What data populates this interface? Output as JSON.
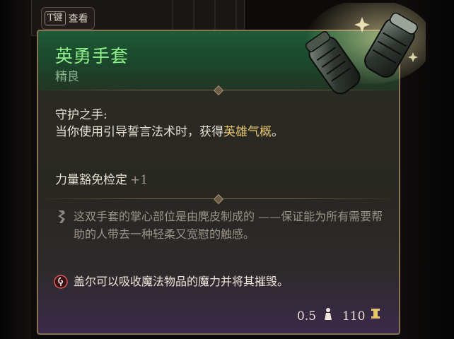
{
  "hint": {
    "key": "T键",
    "label": "查看"
  },
  "item": {
    "name": "英勇手套",
    "rarity": "精良",
    "passive_name": "守护之手:",
    "passive_desc_prefix": "当你使用引导誓言法术时，获得",
    "passive_desc_highlight": "英雄气概",
    "passive_desc_suffix": "。",
    "bonus_label": "力量豁免检定",
    "bonus_value": "+1",
    "lore": "这双手套的掌心部位是由麂皮制成的 ——保证能为所有需要帮助的人带去一种轻柔又宽慰的触感。",
    "warning": "盖尔可以吸收魔法物品的魔力并将其摧毁。",
    "weight": "0.5",
    "price": "110"
  },
  "icons": {
    "lore": "scroll-icon",
    "warning": "swirl-icon",
    "weight": "weight-icon",
    "price": "gold-coin-icon",
    "art": "gauntlets-icon"
  },
  "colors": {
    "rarity_header": "#1f5a36",
    "title": "#8ff08a",
    "highlight": "#e7c76d",
    "border": "#8a7352",
    "footer_accent": "#3b2a4a"
  }
}
